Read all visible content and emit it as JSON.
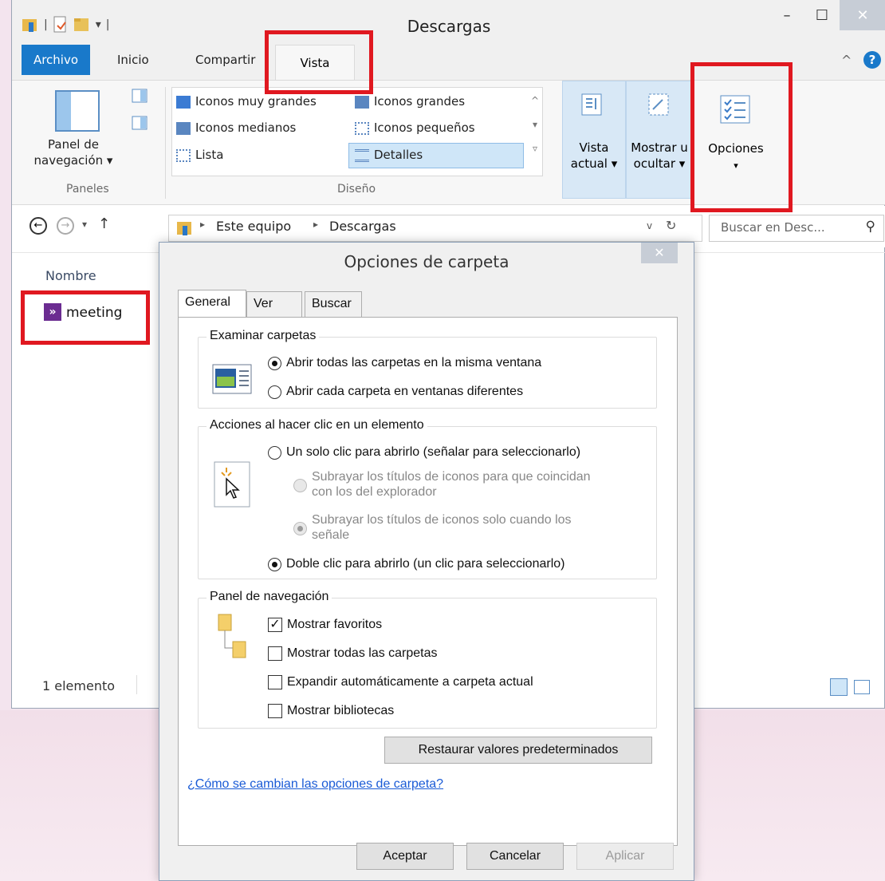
{
  "window": {
    "title": "Descargas"
  },
  "ribbon_tabs": {
    "file": "Archivo",
    "home": "Inicio",
    "share": "Compartir",
    "view": "Vista"
  },
  "ribbon": {
    "panes": {
      "nav_pane_l1": "Panel de",
      "nav_pane_l2": "navegación ▾",
      "group": "Paneles"
    },
    "layout": {
      "group": "Diseño",
      "extra_large": "Iconos muy grandes",
      "large": "Iconos grandes",
      "medium": "Iconos medianos",
      "small": "Iconos pequeños",
      "list": "Lista",
      "details": "Detalles"
    },
    "current_view_l1": "Vista",
    "current_view_l2": "actual ▾",
    "show_hide_l1": "Mostrar u",
    "show_hide_l2": "ocultar ▾",
    "options": "Opciones",
    "options_arrow": "▾"
  },
  "address": {
    "crumb1": "Este equipo",
    "crumb2": "Descargas",
    "search_placeholder": "Buscar en Desc..."
  },
  "file_list": {
    "column_name": "Nombre",
    "items": [
      {
        "name": "meeting"
      }
    ]
  },
  "status": {
    "count": "1 elemento"
  },
  "dialog": {
    "title": "Opciones de carpeta",
    "tabs": {
      "general": "General",
      "view": "Ver",
      "search": "Buscar"
    },
    "browse": {
      "title": "Examinar carpetas",
      "same_window": "Abrir todas las carpetas en la misma ventana",
      "own_window": "Abrir cada carpeta en ventanas diferentes"
    },
    "click": {
      "title": "Acciones al hacer clic en un elemento",
      "single": "Un solo clic para abrirlo (señalar para seleccionarlo)",
      "underline_always_l1": "Subrayar los títulos de iconos para que coincidan",
      "underline_always_l2": "con los del explorador",
      "underline_point_l1": "Subrayar los títulos de iconos solo cuando los",
      "underline_point_l2": "señale",
      "double": "Doble clic para abrirlo (un clic para seleccionarlo)"
    },
    "nav": {
      "title": "Panel de navegación",
      "favorites": "Mostrar favoritos",
      "all_folders": "Mostrar todas las carpetas",
      "expand": "Expandir automáticamente a carpeta actual",
      "libraries": "Mostrar bibliotecas"
    },
    "restore": "Restaurar valores predeterminados",
    "help_link": "¿Cómo se cambian las opciones de carpeta?",
    "ok": "Aceptar",
    "cancel": "Cancelar",
    "apply": "Aplicar"
  },
  "colors": {
    "accent": "#1979ca",
    "highlight": "#e01820"
  }
}
